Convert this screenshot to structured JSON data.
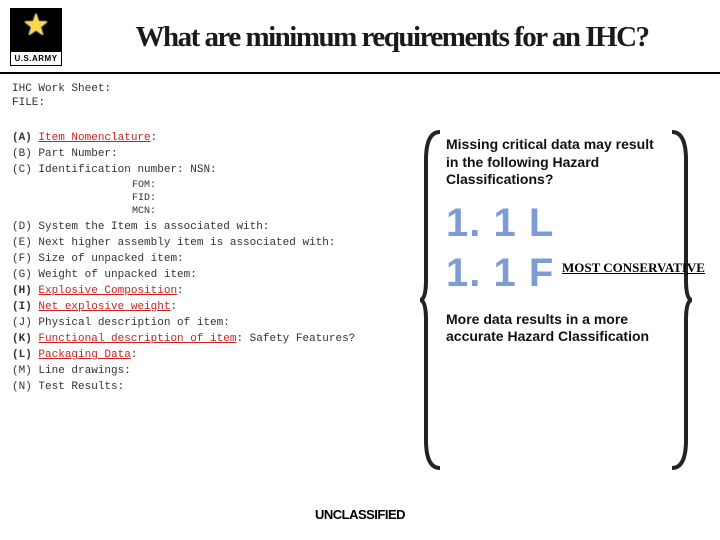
{
  "logo": {
    "caption": "U.S.ARMY"
  },
  "title": "What are minimum requirements for an IHC?",
  "meta": {
    "line1": "IHC Work Sheet:",
    "line2": "FILE:"
  },
  "items": [
    {
      "letter": "(A)",
      "label": "Item Nomenclature",
      "highlight": true,
      "trail": ":"
    },
    {
      "letter": "(B)",
      "label": "Part Number:",
      "highlight": false
    },
    {
      "letter": "(C)",
      "label": "Identification number: NSN:",
      "highlight": false
    },
    {
      "letter": "(D)",
      "label": "System the Item is associated with:",
      "highlight": false
    },
    {
      "letter": "(E)",
      "label": "Next higher assembly item is associated with:",
      "highlight": false
    },
    {
      "letter": "(F)",
      "label": "Size of unpacked item:",
      "highlight": false
    },
    {
      "letter": "(G)",
      "label": "Weight of unpacked item:",
      "highlight": false
    },
    {
      "letter": "(H)",
      "label": "Explosive Composition",
      "highlight": true,
      "trail": ":"
    },
    {
      "letter": "(I)",
      "label": "Net explosive weight",
      "highlight": true,
      "trail": ":"
    },
    {
      "letter": "(J)",
      "label": "Physical description of item:",
      "highlight": false
    },
    {
      "letter": "(K)",
      "label": "Functional description of item",
      "highlight": true,
      "trail": ": Safety Features?"
    },
    {
      "letter": "(L)",
      "label": "Packaging Data",
      "highlight": true,
      "trail": ":"
    },
    {
      "letter": "(M)",
      "label": "Line drawings:",
      "highlight": false
    },
    {
      "letter": "(N)",
      "label": "Test Results:",
      "highlight": false
    }
  ],
  "subitems": {
    "fom": "FOM:",
    "fid": "FID:",
    "mcn": "MCN:"
  },
  "callout": {
    "question": "Missing critical data may result in the following Hazard Classifications?",
    "codes": [
      "1. 1 L",
      "1. 1 F"
    ],
    "most_conservative": "MOST CONSERVATIVE",
    "conclusion": "More data results in a more accurate Hazard Classification"
  },
  "footer": "UNCLASSIFIED"
}
